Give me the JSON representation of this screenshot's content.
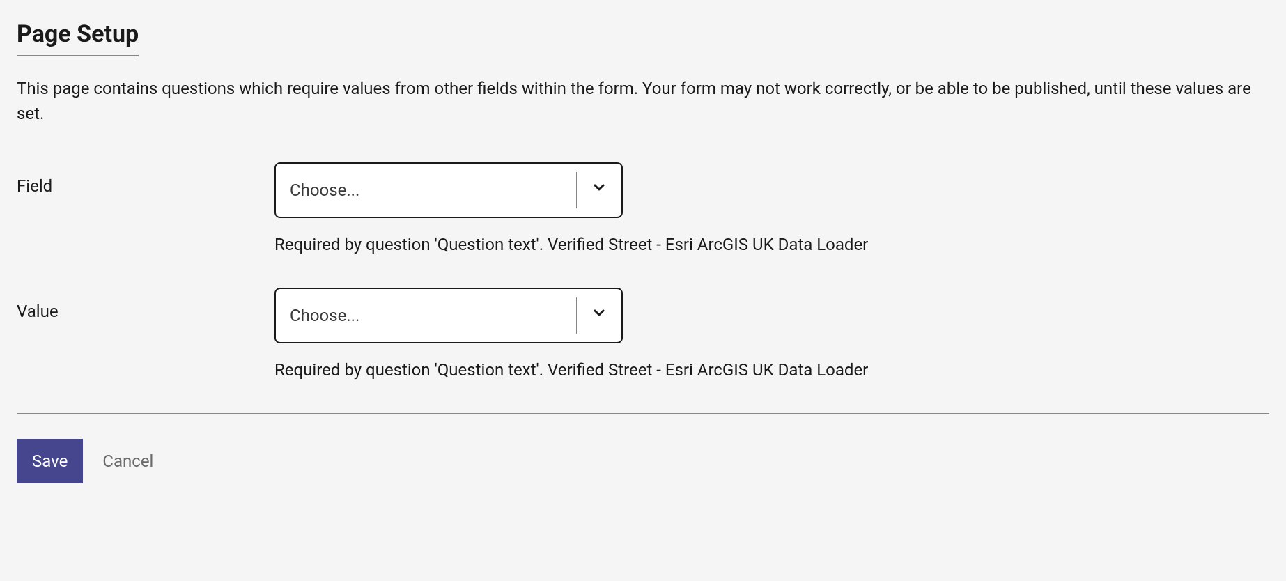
{
  "title": "Page Setup",
  "description": "This page contains questions which require values from other fields within the form. Your form may not work correctly, or be able to be published, until these values are set.",
  "fields": {
    "field": {
      "label": "Field",
      "placeholder": "Choose...",
      "help": "Required by question 'Question text'. Verified Street - Esri ArcGIS UK Data Loader"
    },
    "value": {
      "label": "Value",
      "placeholder": "Choose...",
      "help": "Required by question 'Question text'. Verified Street - Esri ArcGIS UK Data Loader"
    }
  },
  "buttons": {
    "save": "Save",
    "cancel": "Cancel"
  }
}
